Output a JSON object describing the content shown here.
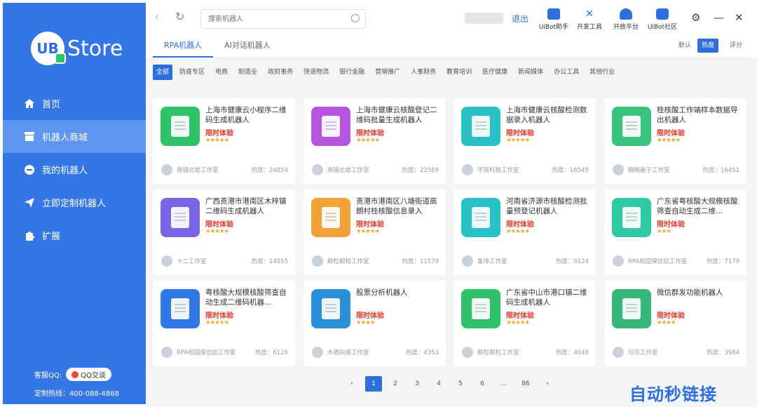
{
  "sidebar": {
    "logo_badge": "UB",
    "logo_text": "Store",
    "items": [
      {
        "label": "首页",
        "icon": "home-icon"
      },
      {
        "label": "机器人商城",
        "icon": "store-icon"
      },
      {
        "label": "我的机器人",
        "icon": "robot-icon"
      },
      {
        "label": "立即定制机器人",
        "icon": "send-icon"
      },
      {
        "label": "扩展",
        "icon": "puzzle-icon"
      }
    ],
    "qq_label": "客服QQ:",
    "qq_button": "QQ交谈",
    "tel": "定制热线：400-088-4868"
  },
  "topbar": {
    "search_placeholder": "搜索机器人",
    "logout": "退出",
    "tools": [
      "UiBot助手",
      "开发工具",
      "开放平台",
      "UiBot社区"
    ]
  },
  "tabs": [
    "RPA机器人",
    "AI对话机器人"
  ],
  "sort": [
    "默认",
    "热度",
    "评分"
  ],
  "filters": [
    "全部",
    "防疫专区",
    "电商",
    "制造业",
    "政府事务",
    "快语物流",
    "银行金融",
    "营销推广",
    "人事财务",
    "教育培训",
    "医疗健康",
    "新闻媒体",
    "办公工具",
    "其他行业"
  ],
  "trial_label": "限时体验",
  "cards": [
    {
      "title": "上海市健康云小程序二维码生成机器人",
      "stars": "★★★★★",
      "studio": "南镜北墟工作室",
      "heat": "热度：24854",
      "color": "#2fc26b"
    },
    {
      "title": "上海市健康云核酸登记二维码批量生成机器人",
      "stars": "★★★★★",
      "studio": "南镜北墟工作室",
      "heat": "热度：22569",
      "color": "#b655e0"
    },
    {
      "title": "上海市健康云核酸检测数据录入机器人",
      "stars": "★★★★★",
      "studio": "宇驾科技工作室",
      "heat": "热度：16545",
      "color": "#27c1c6"
    },
    {
      "title": "桂核酸工作端样本数据导出机器人",
      "stars": "★★★★★",
      "studio": "糊糊鑫子工作室",
      "heat": "热度：16451",
      "color": "#3ac27f"
    },
    {
      "title": "广西贵港市港南区木梓镇二维码生成机器人",
      "stars": "★★★★★",
      "studio": "十二工作室",
      "heat": "热度：14855",
      "color": "#7866e6"
    },
    {
      "title": "贵港市港南区八塘街道高朗村桂核酸信息录入",
      "stars": "★★★★★",
      "studio": "颠粒颠粒工作室",
      "heat": "热度：11579",
      "color": "#f1a33a"
    },
    {
      "title": "河南省济源市核酸检测批量预登记机器人",
      "stars": "★★★★★",
      "studio": "鲁啡工作室",
      "heat": "热度：9124",
      "color": "#27c1c6"
    },
    {
      "title": "广东省粤核酸大规模核酸筛查自动生成二维...",
      "stars": "★★★",
      "studio": "RPA校园保信捻工作室",
      "heat": "热度：7179",
      "color": "#2fcaa5"
    },
    {
      "title": "粤核酸大规模核酸筛查自动生成二维码机器...",
      "stars": "★★★★★",
      "studio": "RPA校园保信捻工作室",
      "heat": "热度：6126",
      "color": "#2f78e6"
    },
    {
      "title": "股票分析机器人",
      "stars": "★★★★",
      "studio": "木栖向南工作室",
      "heat": "热度：4353",
      "color": "#2a8fd8"
    },
    {
      "title": "广东省中山市港口镇二维码生成机器人",
      "stars": "★★★★★",
      "studio": "颠粒颠粒工作室",
      "heat": "热度：4048",
      "color": "#2fc26b"
    },
    {
      "title": "微信群发功能机器人",
      "stars": "★★★★",
      "studio": "可乐工作室",
      "heat": "热度：3984",
      "color": "#36b77a"
    }
  ],
  "pagination": [
    "1",
    "2",
    "3",
    "4",
    "5",
    "6",
    "...",
    "86"
  ],
  "watermark": "自动秒链接",
  "colors": {
    "accent": "#2f6fdd",
    "sidebar": "#3476e4",
    "trial": "#e4392b",
    "star": "#f5a623"
  }
}
